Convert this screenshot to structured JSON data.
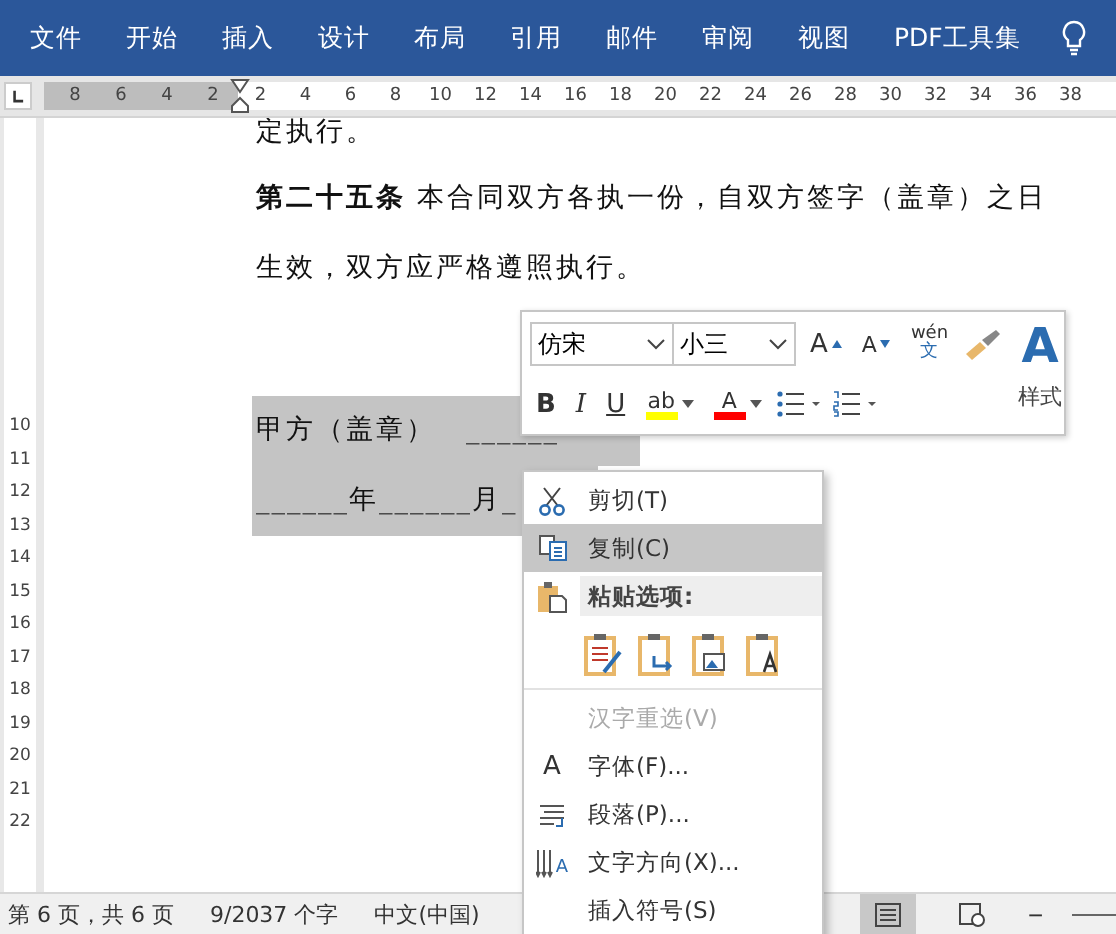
{
  "ribbon": {
    "tabs": [
      {
        "label": "文件",
        "selected": false
      },
      {
        "label": "开始",
        "selected": false
      },
      {
        "label": "插入",
        "selected": false
      },
      {
        "label": "设计",
        "selected": false
      },
      {
        "label": "布局",
        "selected": false
      },
      {
        "label": "引用",
        "selected": false
      },
      {
        "label": "邮件",
        "selected": false
      },
      {
        "label": "审阅",
        "selected": false
      },
      {
        "label": "视图",
        "selected": false
      },
      {
        "label": "PDF工具集",
        "selected": false
      }
    ]
  },
  "ruler": {
    "left_labels": [
      "8",
      "6",
      "4",
      "2"
    ],
    "right_labels": [
      "2",
      "4",
      "6",
      "8",
      "10",
      "12",
      "14",
      "16",
      "18",
      "20",
      "22",
      "24",
      "26",
      "28",
      "30",
      "32",
      "34",
      "36",
      "38"
    ]
  },
  "vertical_ruler": {
    "labels": [
      "10",
      "11",
      "12",
      "13",
      "14",
      "15",
      "16",
      "17",
      "18",
      "19",
      "20",
      "21",
      "22"
    ]
  },
  "document": {
    "lines": [
      {
        "text": "定执行。",
        "selected": false
      },
      {
        "text": "**第二十五条** 本合同双方各执一份，自双方签字（盖章）之日",
        "selected": false
      },
      {
        "text": "生效，双方应严格遵照执行。",
        "selected": false
      },
      {
        "text": "甲方（盖章）　______",
        "selected": true
      },
      {
        "text": "______年______月_",
        "selected": true
      }
    ]
  },
  "mini_toolbar": {
    "font": "仿宋",
    "size": "小三",
    "row1": [
      {
        "kind": "grow",
        "glyph": "A"
      },
      {
        "kind": "shrink",
        "glyph": "A"
      },
      {
        "kind": "phonetic",
        "glyph": "wén",
        "sub": "文"
      },
      {
        "kind": "painter"
      }
    ],
    "row2": [
      {
        "kind": "bold",
        "glyph": "B"
      },
      {
        "kind": "italic",
        "glyph": "I"
      },
      {
        "kind": "underline",
        "glyph": "U"
      },
      {
        "kind": "highlight",
        "glyph": "ab",
        "color": "#ffff00"
      },
      {
        "kind": "fontcolor",
        "glyph": "A",
        "color": "#ff0000"
      },
      {
        "kind": "bullets"
      },
      {
        "kind": "numbering"
      }
    ],
    "styles": {
      "glyph": "A",
      "label": "样式"
    }
  },
  "context_menu": [
    {
      "kind": "item",
      "label": "剪切(T)",
      "selected": false,
      "disabled": false
    },
    {
      "kind": "item",
      "label": "复制(C)",
      "selected": true,
      "disabled": false
    },
    {
      "kind": "header",
      "label": "粘贴选项:"
    },
    {
      "kind": "paste-options"
    },
    {
      "kind": "item",
      "label": "汉字重选(V)",
      "selected": false,
      "disabled": true
    },
    {
      "kind": "item",
      "glyph": "A",
      "label": "字体(F)...",
      "selected": false,
      "disabled": false
    },
    {
      "kind": "item",
      "label": "段落(P)...",
      "selected": false,
      "disabled": false
    },
    {
      "kind": "item",
      "glyph": "A",
      "label": "文字方向(X)...",
      "selected": false,
      "disabled": false
    },
    {
      "kind": "item",
      "label": "插入符号(S)",
      "selected": false,
      "disabled": false
    }
  ],
  "status_bar": {
    "page": "第 6 页，共 6 页",
    "words": "9/2037 个字",
    "language": "中文(中国)",
    "zoom_out": "−"
  }
}
